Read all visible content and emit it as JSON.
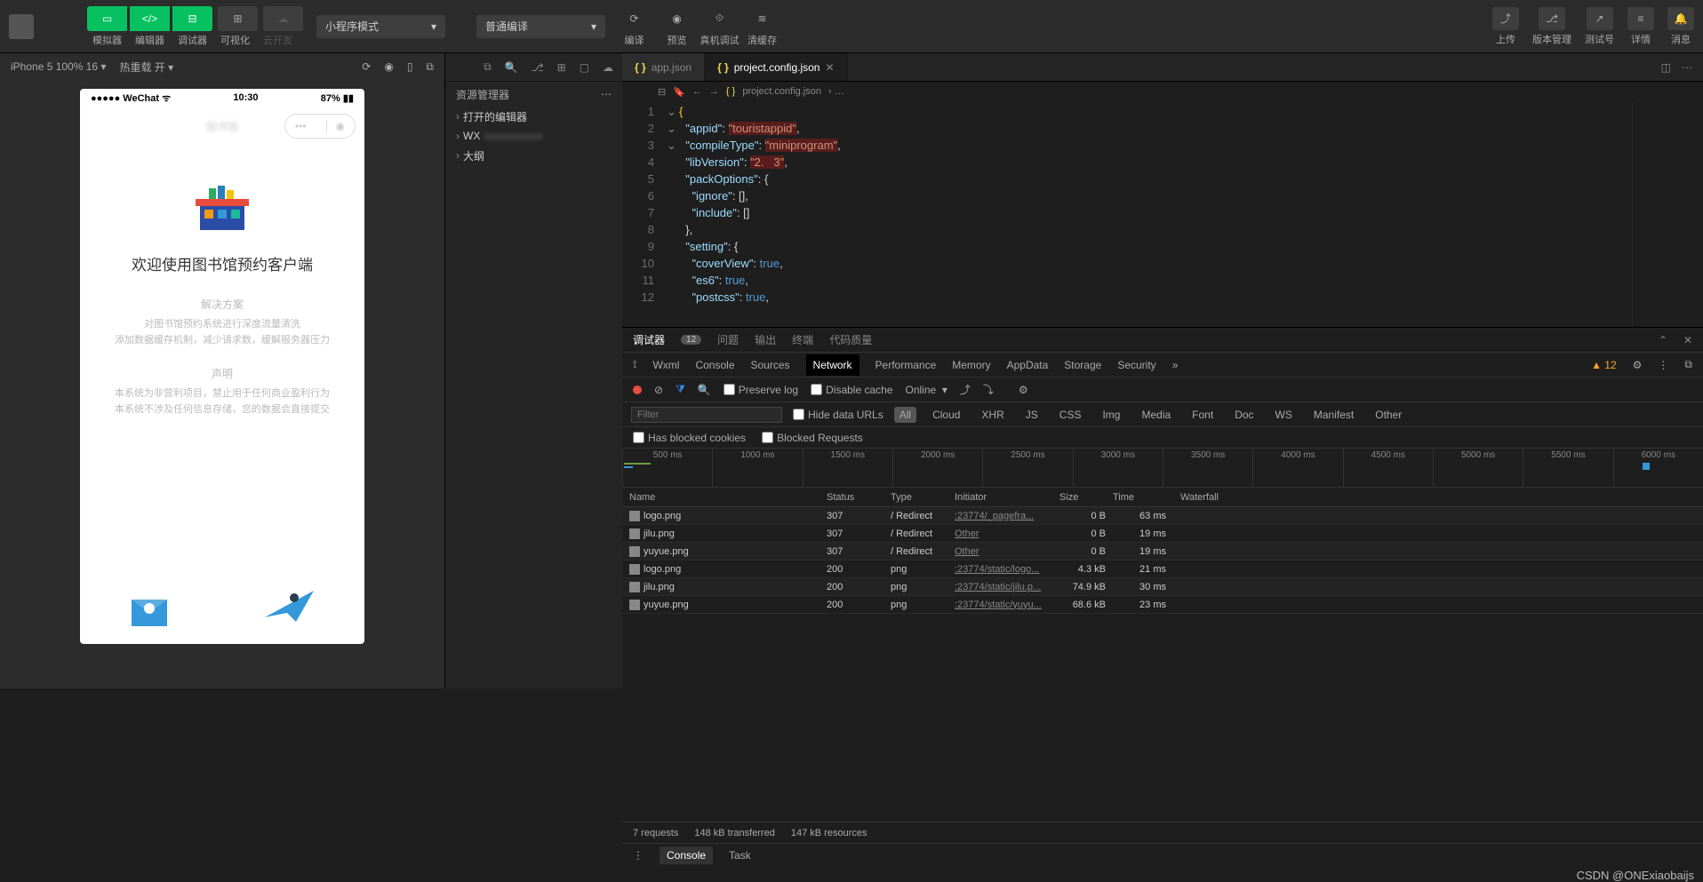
{
  "topbar": {
    "mode_buttons": [
      "模拟器",
      "编辑器",
      "调试器",
      "可视化",
      "云开发"
    ],
    "dropdown1": "小程序模式",
    "dropdown2": "普通编译",
    "compile_tools": [
      "编译",
      "预览",
      "真机调试",
      "清缓存"
    ],
    "right_tools": [
      "上传",
      "版本管理",
      "测试号",
      "详情",
      "消息"
    ]
  },
  "sim": {
    "device": "iPhone 5 100% 16",
    "hot": "热重载 开",
    "phone": {
      "carrier": "WeChat",
      "time": "10:30",
      "battery": "87%",
      "welcome": "欢迎使用图书馆预约客户端",
      "s1t": "解决方案",
      "s1d1": "对图书馆预约系统进行深度流量清洗",
      "s1d2": "添加数据缓存机制，减少请求数，缓解服务器压力",
      "s2t": "声明",
      "s2d1": "本系统为非营利项目，禁止用于任何商业盈利行为",
      "s2d2": "本系统不涉及任何信息存储，您的数据会直接提交"
    }
  },
  "explorer": {
    "title": "资源管理器",
    "items": [
      "打开的编辑器",
      "WX",
      "大纲"
    ]
  },
  "tabs": {
    "t1": "app.json",
    "t2": "project.config.json"
  },
  "crumbs": {
    "file": "project.config.json",
    "sep": "›  …"
  },
  "code": {
    "lines": [
      "1",
      "2",
      "3",
      "4",
      "5",
      "6",
      "7",
      "8",
      "9",
      "10",
      "11",
      "12"
    ],
    "l1": "{",
    "l2a": "  \"appid\"",
    "l2b": ": ",
    "l2c": "\"touristappid\"",
    "l2d": ",",
    "l3a": "  \"compileType\"",
    "l3b": ": ",
    "l3c": "\"miniprogram\"",
    "l3d": ",",
    "l4a": "  \"libVersion\"",
    "l4b": ": ",
    "l4c": "\"2.   3\"",
    "l4d": ",",
    "l5a": "  \"packOptions\"",
    "l5b": ": {",
    "l6a": "    \"ignore\"",
    "l6b": ": [],",
    "l7a": "    \"include\"",
    "l7b": ": []",
    "l8": "  },",
    "l9a": "  \"setting\"",
    "l9b": ": {",
    "l10a": "    \"coverView\"",
    "l10b": ": ",
    "l10c": "true",
    "l10d": ",",
    "l11a": "    \"es6\"",
    "l11b": ": ",
    "l11c": "true",
    "l11d": ",",
    "l12a": "    \"postcss\"",
    "l12b": ": ",
    "l12c": "true",
    "l12d": ","
  },
  "dev": {
    "top_tabs": [
      "调试器",
      "问题",
      "输出",
      "终端",
      "代码质量"
    ],
    "badge": "12",
    "dt_tabs": [
      "Wxml",
      "Console",
      "Sources",
      "Network",
      "Performance",
      "Memory",
      "AppData",
      "Storage",
      "Security"
    ],
    "warn": "▲ 12",
    "bar": {
      "preserve": "Preserve log",
      "disable": "Disable cache",
      "online": "Online"
    },
    "filter": {
      "placeholder": "Filter",
      "hide": "Hide data URLs",
      "types": [
        "All",
        "Cloud",
        "XHR",
        "JS",
        "CSS",
        "Img",
        "Media",
        "Font",
        "Doc",
        "WS",
        "Manifest",
        "Other"
      ]
    },
    "filter2": {
      "blocked": "Has blocked cookies",
      "breq": "Blocked Requests"
    },
    "tl": [
      "500 ms",
      "1000 ms",
      "1500 ms",
      "2000 ms",
      "2500 ms",
      "3000 ms",
      "3500 ms",
      "4000 ms",
      "4500 ms",
      "5000 ms",
      "5500 ms",
      "6000 ms"
    ],
    "cols": [
      "Name",
      "Status",
      "Type",
      "Initiator",
      "Size",
      "Time",
      "Waterfall"
    ],
    "rows": [
      {
        "name": "logo.png",
        "status": "307",
        "type": "/ Redirect",
        "init": ":23774/_pagefra...",
        "size": "0 B",
        "time": "63 ms"
      },
      {
        "name": "jilu.png",
        "status": "307",
        "type": "/ Redirect",
        "init": "Other",
        "size": "0 B",
        "time": "19 ms"
      },
      {
        "name": "yuyue.png",
        "status": "307",
        "type": "/ Redirect",
        "init": "Other",
        "size": "0 B",
        "time": "19 ms"
      },
      {
        "name": "logo.png",
        "status": "200",
        "type": "png",
        "init": ":23774/static/logo...",
        "size": "4.3 kB",
        "time": "21 ms"
      },
      {
        "name": "jilu.png",
        "status": "200",
        "type": "png",
        "init": ":23774/static/jilu.p...",
        "size": "74.9 kB",
        "time": "30 ms"
      },
      {
        "name": "yuyue.png",
        "status": "200",
        "type": "png",
        "init": ":23774/static/yuyu...",
        "size": "68.6 kB",
        "time": "23 ms"
      }
    ],
    "foot": [
      "7 requests",
      "148 kB transferred",
      "147 kB resources"
    ],
    "drawer": [
      "Console",
      "Task"
    ]
  },
  "watermark": "CSDN @ONExiaobaijs"
}
